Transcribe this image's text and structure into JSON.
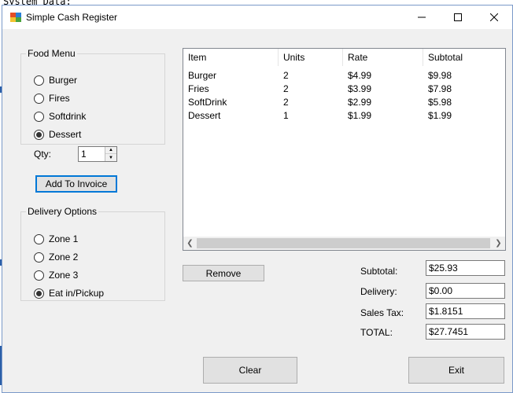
{
  "background": {
    "text": "System Data:"
  },
  "window": {
    "title": "Simple Cash Register"
  },
  "food_menu": {
    "legend": "Food Menu",
    "options": [
      {
        "label": "Burger",
        "checked": false
      },
      {
        "label": "Fires",
        "checked": false
      },
      {
        "label": "Softdrink",
        "checked": false
      },
      {
        "label": "Dessert",
        "checked": true
      }
    ]
  },
  "qty": {
    "label": "Qty:",
    "value": "1"
  },
  "add_button": {
    "label": "Add To Invoice"
  },
  "delivery": {
    "legend": "Delivery Options",
    "options": [
      {
        "label": "Zone 1",
        "checked": false
      },
      {
        "label": "Zone 2",
        "checked": false
      },
      {
        "label": "Zone 3",
        "checked": false
      },
      {
        "label": "Eat in/Pickup",
        "checked": true
      }
    ]
  },
  "invoice": {
    "columns": [
      "Item",
      "Units",
      "Rate",
      "Subtotal"
    ],
    "rows": [
      [
        "Burger",
        "2",
        "$4.99",
        "$9.98"
      ],
      [
        "Fries",
        "2",
        "$3.99",
        "$7.98"
      ],
      [
        "SoftDrink",
        "2",
        "$2.99",
        "$5.98"
      ],
      [
        "Dessert",
        "1",
        "$1.99",
        "$1.99"
      ]
    ]
  },
  "remove_button": {
    "label": "Remove"
  },
  "totals": {
    "subtotal_label": "Subtotal:",
    "subtotal_value": "$25.93",
    "delivery_label": "Delivery:",
    "delivery_value": "$0.00",
    "tax_label": "Sales Tax:",
    "tax_value": "$1.8151",
    "total_label": "TOTAL:",
    "total_value": "$27.7451"
  },
  "clear_button": {
    "label": "Clear"
  },
  "exit_button": {
    "label": "Exit"
  }
}
